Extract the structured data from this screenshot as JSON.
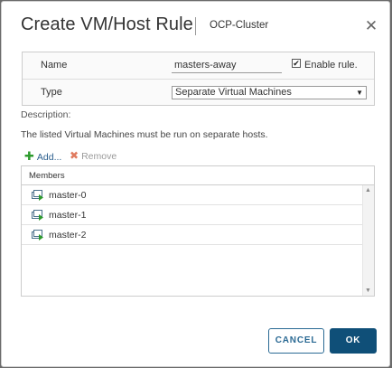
{
  "dialog": {
    "title": "Create VM/Host Rule",
    "subtitle": "OCP-Cluster",
    "close_icon": "close-icon"
  },
  "form": {
    "name_label": "Name",
    "name_value": "masters-away",
    "enable_rule_label": "Enable rule.",
    "enable_rule_checked": true,
    "type_label": "Type",
    "type_value": "Separate Virtual Machines"
  },
  "description": {
    "label": "Description:",
    "text": "The listed Virtual Machines must be run on separate hosts."
  },
  "toolbar": {
    "add_label": "Add...",
    "remove_label": "Remove"
  },
  "members": {
    "header": "Members",
    "rows": [
      {
        "name": "master-0",
        "icon": "vm-powered-on-icon"
      },
      {
        "name": "master-1",
        "icon": "vm-powered-on-icon"
      },
      {
        "name": "master-2",
        "icon": "vm-powered-on-icon"
      }
    ]
  },
  "footer": {
    "cancel_label": "CANCEL",
    "ok_label": "OK"
  },
  "colors": {
    "primary": "#0f4f78",
    "link": "#2b5f8e",
    "add_icon": "#2e9b2e",
    "remove_icon": "#e07a5f"
  }
}
